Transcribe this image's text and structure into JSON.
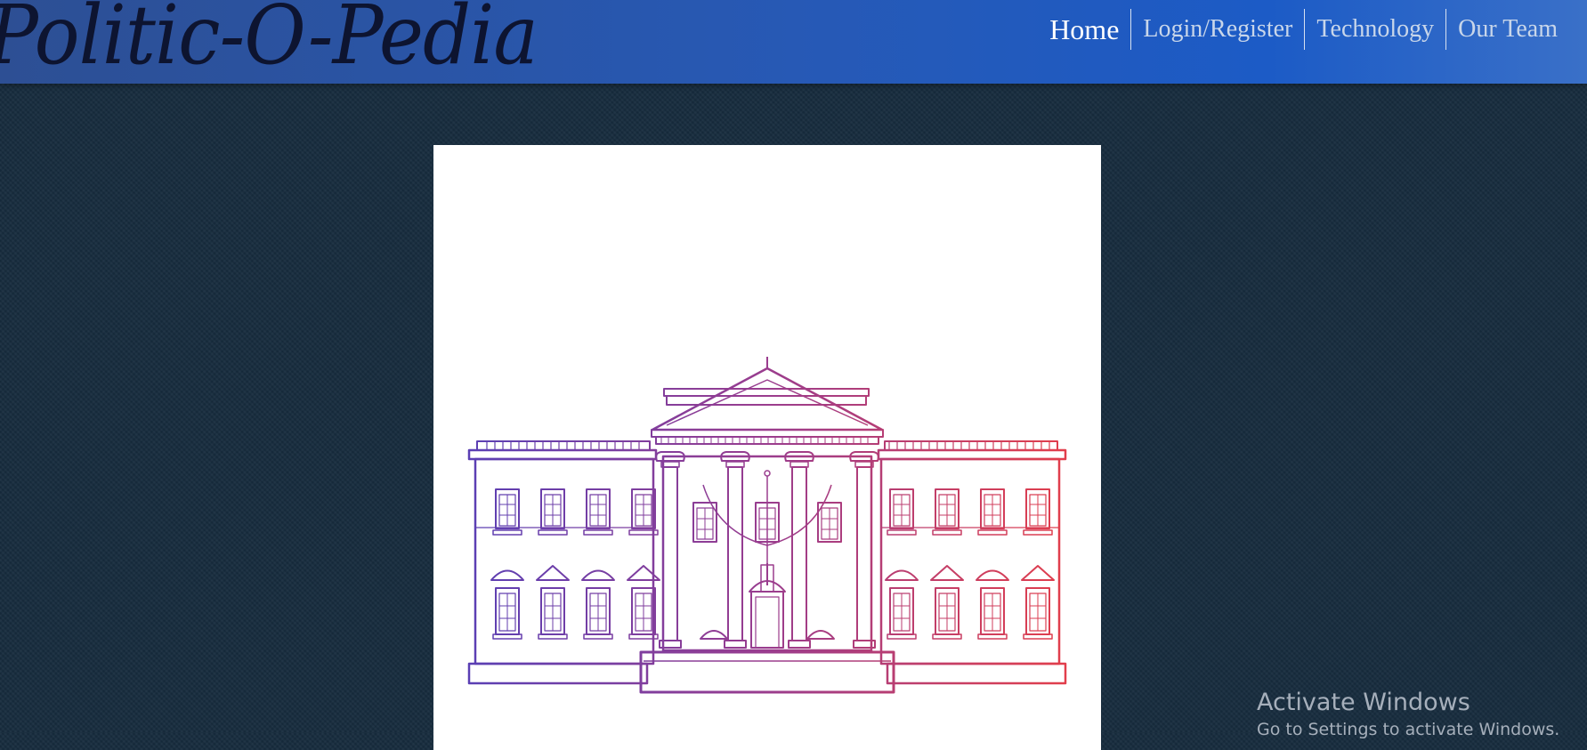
{
  "brand": {
    "name": "Politic-O-Pedia"
  },
  "nav": {
    "items": [
      {
        "label": "Home",
        "active": true
      },
      {
        "label": "Login/Register",
        "active": false
      },
      {
        "label": "Technology",
        "active": false
      },
      {
        "label": "Our Team",
        "active": false
      }
    ]
  },
  "hero": {
    "image_subject": "white-house-illustration"
  },
  "gradient_colors": [
    "#5a3fb4",
    "#9a3d8e",
    "#e23e4b"
  ],
  "watermark": {
    "title": "Activate Windows",
    "subtitle": "Go to Settings to activate Windows."
  }
}
